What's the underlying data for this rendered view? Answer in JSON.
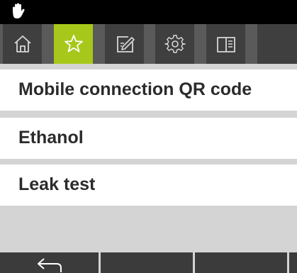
{
  "status": {
    "icon": "hand-icon"
  },
  "tabs": [
    {
      "icon": "home-icon",
      "active": false
    },
    {
      "icon": "star-icon",
      "active": true
    },
    {
      "icon": "edit-icon",
      "active": false
    },
    {
      "icon": "gear-icon",
      "active": false
    },
    {
      "icon": "book-icon",
      "active": false
    }
  ],
  "favorites": [
    {
      "label": "Mobile connection QR code"
    },
    {
      "label": "Ethanol"
    },
    {
      "label": "Leak test"
    }
  ],
  "bottom_bar": {
    "buttons": [
      {
        "icon": "back-arrow-icon"
      },
      {
        "icon": ""
      },
      {
        "icon": ""
      },
      {
        "icon": ""
      }
    ]
  },
  "colors": {
    "accent": "#a7c81a",
    "tab_bg": "#3f3f3f",
    "status_bg": "#000000"
  }
}
